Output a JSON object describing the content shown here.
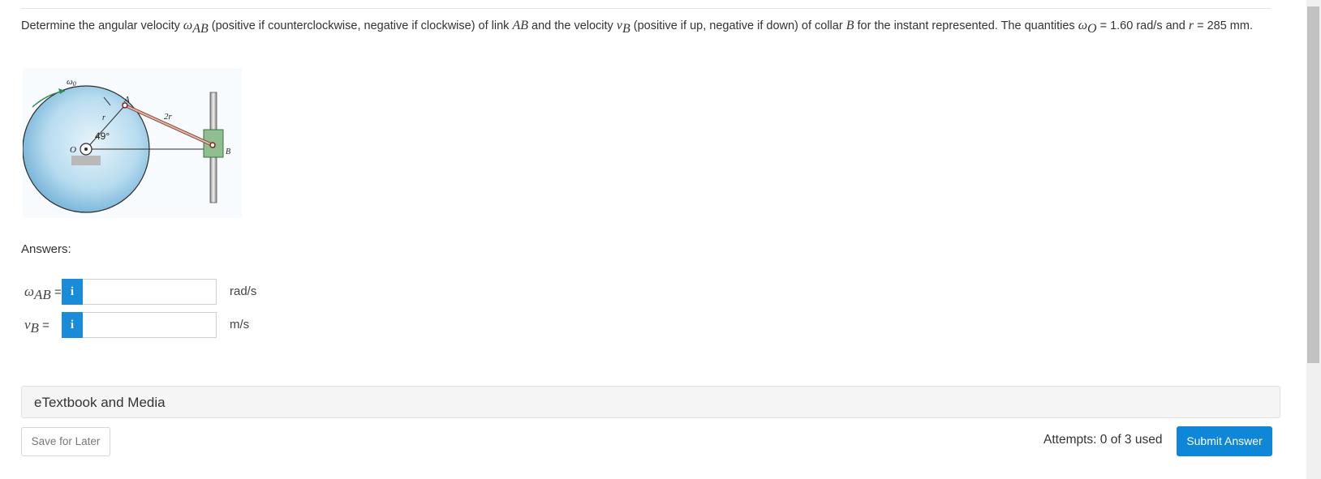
{
  "question": {
    "t1": "Determine the angular velocity ",
    "t2": " (positive if counterclockwise, negative if clockwise) of link ",
    "t3": " and the velocity ",
    "t4": " (positive if up, negative if down) of collar ",
    "t5": " for the instant represented. The quantities ",
    "t6": " = 1.60 rad/s and ",
    "t7": " = 285 mm.",
    "omega": "ω",
    "ab_sub": "AB",
    "v": "v",
    "b_sub": "B",
    "link_ab": "AB",
    "collar_b": "B",
    "o_sub": "O",
    "r": "r"
  },
  "diagram": {
    "omega_label": "ω",
    "omega_sub": "0",
    "label_a": "A",
    "label_2r": "2r",
    "label_r": "r",
    "label_o": "O",
    "label_angle": "49°",
    "label_b": "B"
  },
  "answers": {
    "heading": "Answers:",
    "rows": [
      {
        "sym": "ω",
        "sub": "AB",
        "eq": " =",
        "info": "i",
        "value": "",
        "unit": "rad/s"
      },
      {
        "sym": "v",
        "sub": "B",
        "eq": " =",
        "info": "i",
        "value": "",
        "unit": "m/s"
      }
    ]
  },
  "etextbook": "eTextbook and Media",
  "footer": {
    "save": "Save for Later",
    "attempts": "Attempts: 0 of 3 used",
    "submit": "Submit Answer"
  },
  "colors": {
    "accent": "#1a8bd8",
    "submit": "#0e87d9",
    "link": "#e4b5a8",
    "collar": "#8fbf90",
    "disk": "#a9d4ea"
  }
}
